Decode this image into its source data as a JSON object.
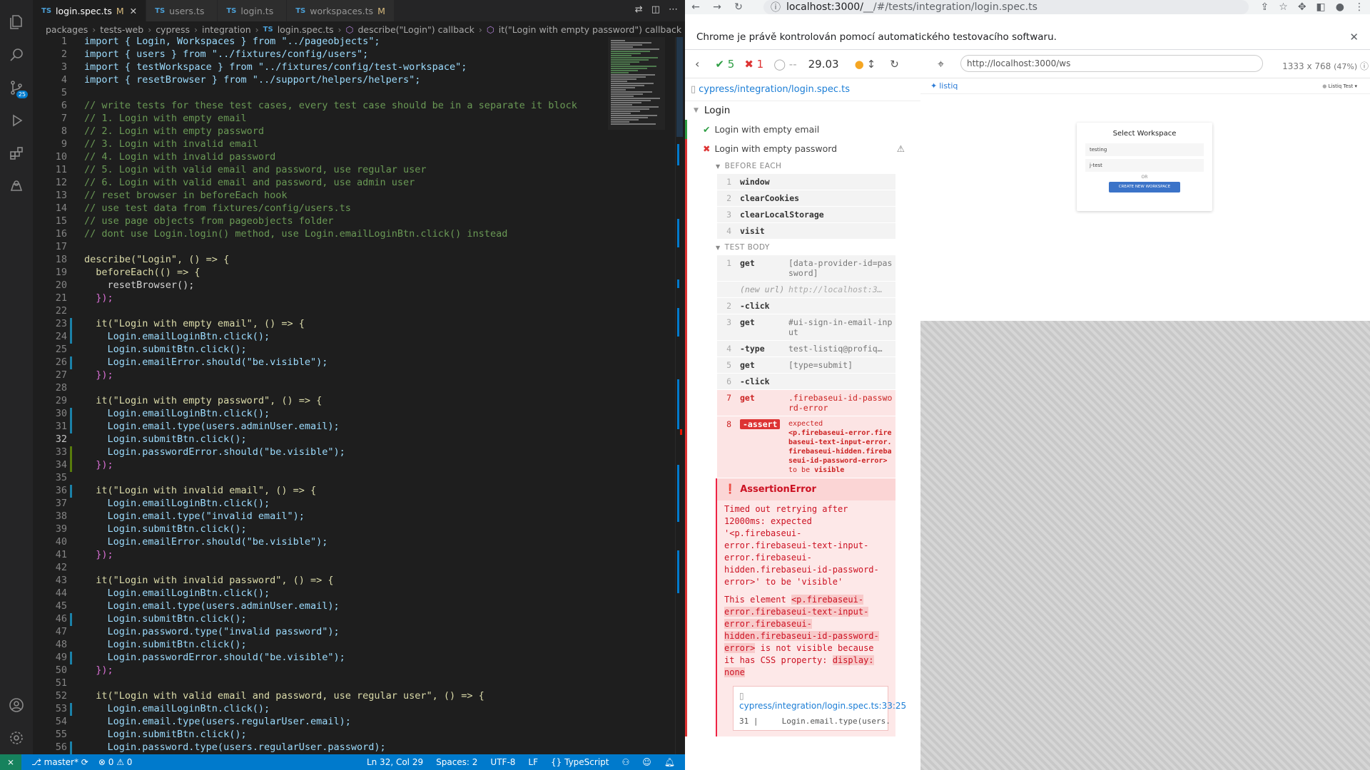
{
  "vscode": {
    "tabs": [
      {
        "label": "login.spec.ts",
        "modified": "M",
        "active": true
      },
      {
        "label": "users.ts",
        "modified": "",
        "active": false
      },
      {
        "label": "login.ts",
        "modified": "",
        "active": false
      },
      {
        "label": "workspaces.ts",
        "modified": "M",
        "active": false
      }
    ],
    "tab_lang": "TS",
    "breadcrumb": [
      "packages",
      "tests-web",
      "cypress",
      "integration",
      "login.spec.ts",
      "describe(\"Login\") callback",
      "it(\"Login with empty password\") callback"
    ],
    "badge": "25",
    "lines": [
      {
        "n": "1",
        "t": "import { Login, Workspaces } from \"../pageobjects\";"
      },
      {
        "n": "2",
        "t": "import { users } from \"../fixtures/config/users\";"
      },
      {
        "n": "3",
        "t": "import { testWorkspace } from \"../fixtures/config/test-workspace\";"
      },
      {
        "n": "4",
        "t": "import { resetBrowser } from \"../support/helpers/helpers\";"
      },
      {
        "n": "5",
        "t": ""
      },
      {
        "n": "6",
        "t": "// write tests for these test cases, every test case should be in a separate it block"
      },
      {
        "n": "7",
        "t": "// 1. Login with empty email"
      },
      {
        "n": "8",
        "t": "// 2. Login with empty password"
      },
      {
        "n": "9",
        "t": "// 3. Login with invalid email"
      },
      {
        "n": "10",
        "t": "// 4. Login with invalid password"
      },
      {
        "n": "11",
        "t": "// 5. Login with valid email and password, use regular user"
      },
      {
        "n": "12",
        "t": "// 6. Login with valid email and password, use admin user"
      },
      {
        "n": "13",
        "t": "// reset browser in beforeEach hook"
      },
      {
        "n": "14",
        "t": "// use test data from fixtures/config/users.ts"
      },
      {
        "n": "15",
        "t": "// use page objects from pageobjects folder"
      },
      {
        "n": "16",
        "t": "// dont use Login.login() method, use Login.emailLoginBtn.click() instead"
      },
      {
        "n": "17",
        "t": ""
      },
      {
        "n": "18",
        "t": "describe(\"Login\", () => {"
      },
      {
        "n": "19",
        "t": "  beforeEach(() => {"
      },
      {
        "n": "20",
        "t": "    resetBrowser();"
      },
      {
        "n": "21",
        "t": "  });"
      },
      {
        "n": "22",
        "t": ""
      },
      {
        "n": "23",
        "t": "  it(\"Login with empty email\", () => {"
      },
      {
        "n": "24",
        "t": "    Login.emailLoginBtn.click();"
      },
      {
        "n": "25",
        "t": "    Login.submitBtn.click();"
      },
      {
        "n": "26",
        "t": "    Login.emailError.should(\"be.visible\");"
      },
      {
        "n": "27",
        "t": "  });"
      },
      {
        "n": "28",
        "t": ""
      },
      {
        "n": "29",
        "t": "  it(\"Login with empty password\", () => {"
      },
      {
        "n": "30",
        "t": "    Login.emailLoginBtn.click();"
      },
      {
        "n": "31",
        "t": "    Login.email.type(users.adminUser.email);"
      },
      {
        "n": "32",
        "t": "    Login.submitBtn.click();"
      },
      {
        "n": "33",
        "t": "    Login.passwordError.should(\"be.visible\");"
      },
      {
        "n": "34",
        "t": "  });"
      },
      {
        "n": "35",
        "t": ""
      },
      {
        "n": "36",
        "t": "  it(\"Login with invalid email\", () => {"
      },
      {
        "n": "37",
        "t": "    Login.emailLoginBtn.click();"
      },
      {
        "n": "38",
        "t": "    Login.email.type(\"invalid email\");"
      },
      {
        "n": "39",
        "t": "    Login.submitBtn.click();"
      },
      {
        "n": "40",
        "t": "    Login.emailError.should(\"be.visible\");"
      },
      {
        "n": "41",
        "t": "  });"
      },
      {
        "n": "42",
        "t": ""
      },
      {
        "n": "43",
        "t": "  it(\"Login with invalid password\", () => {"
      },
      {
        "n": "44",
        "t": "    Login.emailLoginBtn.click();"
      },
      {
        "n": "45",
        "t": "    Login.email.type(users.adminUser.email);"
      },
      {
        "n": "46",
        "t": "    Login.submitBtn.click();"
      },
      {
        "n": "47",
        "t": "    Login.password.type(\"invalid password\");"
      },
      {
        "n": "48",
        "t": "    Login.submitBtn.click();"
      },
      {
        "n": "49",
        "t": "    Login.passwordError.should(\"be.visible\");"
      },
      {
        "n": "50",
        "t": "  });"
      },
      {
        "n": "51",
        "t": ""
      },
      {
        "n": "52",
        "t": "  it(\"Login with valid email and password, use regular user\", () => {"
      },
      {
        "n": "53",
        "t": "    Login.emailLoginBtn.click();"
      },
      {
        "n": "54",
        "t": "    Login.email.type(users.regularUser.email);"
      },
      {
        "n": "55",
        "t": "    Login.submitBtn.click();"
      },
      {
        "n": "56",
        "t": "    Login.password.type(users.regularUser.password);"
      }
    ],
    "status": {
      "branch": "master*",
      "errors": "0",
      "warnings": "0",
      "position": "Ln 32, Col 29",
      "spaces": "Spaces: 2",
      "encoding": "UTF-8",
      "eol": "LF",
      "lang_braces": "{}",
      "language": "TypeScript"
    }
  },
  "chrome": {
    "url_host": "localhost:3000/",
    "url_path": "__/#/tests/integration/login.spec.ts",
    "infobar": "Chrome je právě kontrolován pomocí automatického testovacího softwaru."
  },
  "cypress": {
    "passed": "5",
    "failed": "1",
    "pending": "--",
    "duration": "29.03",
    "spec": "cypress/integration/login.spec.ts",
    "suite": "Login",
    "tests": [
      {
        "label": "Login with empty email",
        "state": "pass"
      },
      {
        "label": "Login with empty password",
        "state": "fail"
      }
    ],
    "before_each_label": "BEFORE EACH",
    "before_each": [
      {
        "n": "1",
        "name": "window",
        "msg": ""
      },
      {
        "n": "2",
        "name": "clearCookies",
        "msg": ""
      },
      {
        "n": "3",
        "name": "clearLocalStorage",
        "msg": ""
      },
      {
        "n": "4",
        "name": "visit",
        "msg": ""
      }
    ],
    "test_body_label": "TEST BODY",
    "body": [
      {
        "n": "1",
        "name": "get",
        "msg": "[data-provider-id=password]"
      },
      {
        "n": "",
        "name": "(new url)",
        "msg": "http://localhost:3…"
      },
      {
        "n": "2",
        "name": "-click",
        "msg": ""
      },
      {
        "n": "3",
        "name": "get",
        "msg": "#ui-sign-in-email-input"
      },
      {
        "n": "4",
        "name": "-type",
        "msg": "test-listiq@profiq…"
      },
      {
        "n": "5",
        "name": "get",
        "msg": "[type=submit]"
      },
      {
        "n": "6",
        "name": "-click",
        "msg": ""
      },
      {
        "n": "7",
        "name": "get",
        "msg": ".firebaseui-id-password-error"
      }
    ],
    "assert": {
      "n": "8",
      "name": "-assert",
      "msg_pre": "expected",
      "msg_el": "<p.firebaseui-error.firebaseui-text-input-error.firebaseui-hidden.firebaseui-id-password-error>",
      "msg_to": "to be",
      "msg_vis": "visible"
    },
    "error": {
      "title": "AssertionError",
      "p1": "Timed out retrying after 12000ms: expected '<p.firebaseui-error.firebaseui-text-input-error.firebaseui-hidden.firebaseui-id-password-error>' to be 'visible'",
      "p2_pre": "This element",
      "p2_code": "<p.firebaseui-error.firebaseui-text-input-error.firebaseui-hidden.firebaseui-id-password-error>",
      "p2_post": "is not visible because it has CSS property:",
      "p2_prop": "display: none",
      "frame_file": "cypress/integration/login.spec.ts:33:25",
      "frame_line": "31 |     Login.email.type(users."
    },
    "aut_url": "http://localhost:3000/ws",
    "viewport": "1333 x 768",
    "scale": "(47%)",
    "app": {
      "brand": "listiq",
      "user": "Listiq Test",
      "title": "Select Workspace",
      "workspaces": [
        "testing",
        "j-test"
      ],
      "or": "OR",
      "create_btn": "CREATE NEW WORKSPACE"
    }
  }
}
